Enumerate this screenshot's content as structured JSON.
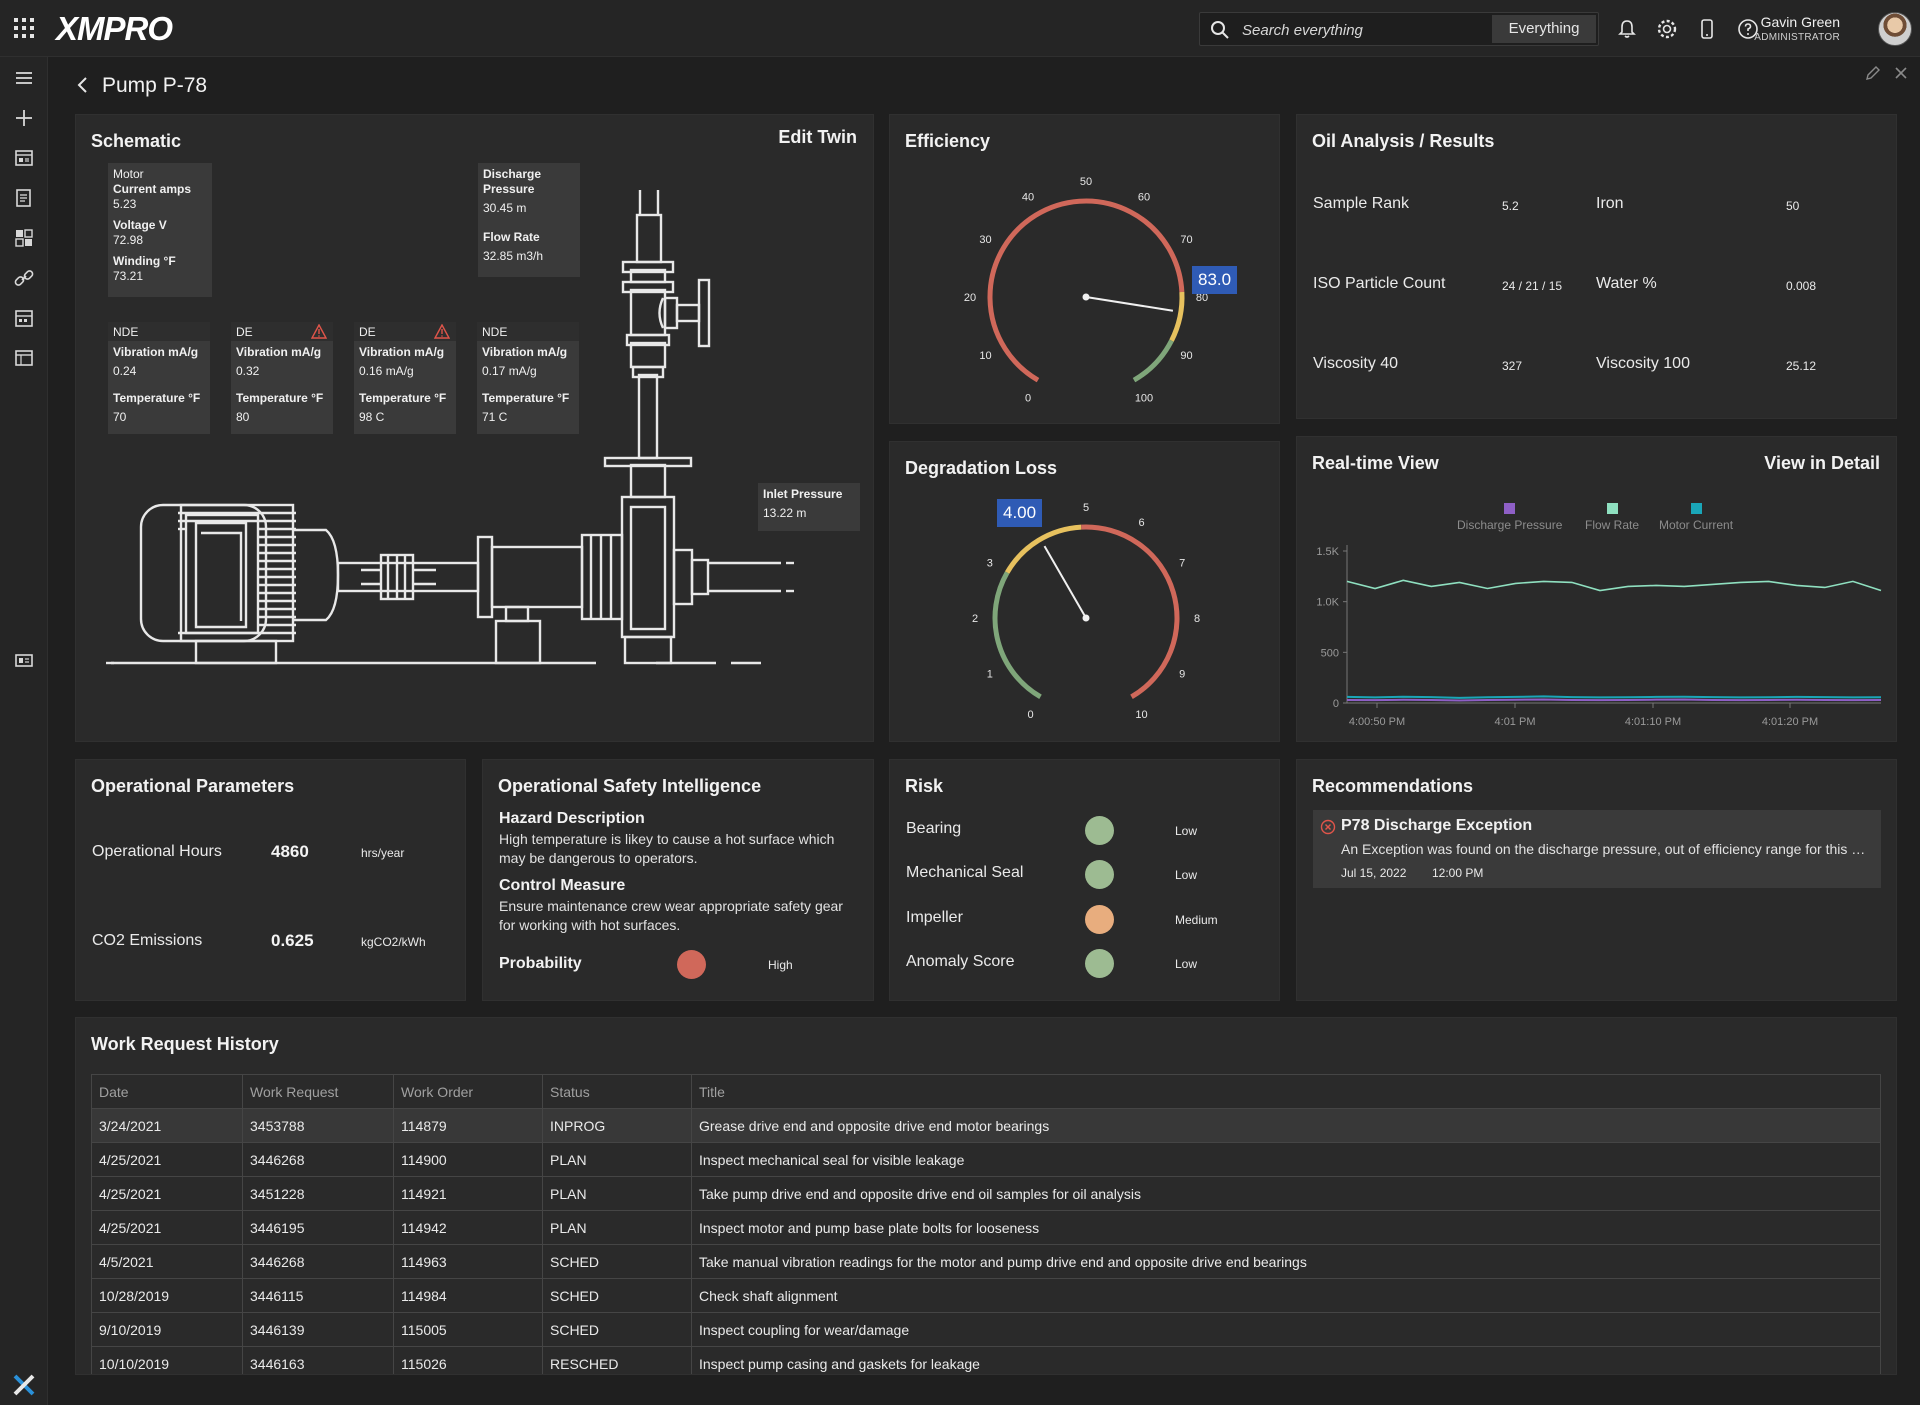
{
  "app": {
    "logo": "XMPRO"
  },
  "search": {
    "placeholder": "Search everything",
    "scope": "Everything"
  },
  "user": {
    "name": "Gavin Green",
    "role": "ADMINISTRATOR"
  },
  "page": {
    "title": "Pump P-78"
  },
  "schematic": {
    "title": "Schematic",
    "action": "Edit Twin",
    "motor": {
      "header": "Motor",
      "current_label": "Current amps",
      "current_value": "5.23",
      "voltage_label": "Voltage V",
      "voltage_value": "72.98",
      "winding_label": "Winding °F",
      "winding_value": "73.21"
    },
    "discharge": {
      "pressure_label": "Discharge Pressure",
      "pressure_value": "30.45 m",
      "flow_label": "Flow Rate",
      "flow_value": "32.85 m3/h"
    },
    "inlet": {
      "label": "Inlet Pressure",
      "value": "13.22 m"
    },
    "sensors": [
      {
        "header": "NDE",
        "vib_label": "Vibration mA/g",
        "vib_value": "0.24",
        "temp_label": "Temperature °F",
        "temp_value": "70",
        "warning": false
      },
      {
        "header": "DE",
        "vib_label": "Vibration mA/g",
        "vib_value": "0.32",
        "temp_label": "Temperature °F",
        "temp_value": "80",
        "warning": true
      },
      {
        "header": "DE",
        "vib_label": "Vibration mA/g",
        "vib_value": "0.16 mA/g",
        "temp_label": "Temperature °F",
        "temp_value": "98 C",
        "warning": true
      },
      {
        "header": "NDE",
        "vib_label": "Vibration mA/g",
        "vib_value": "0.17 mA/g",
        "temp_label": "Temperature °F",
        "temp_value": "71 C",
        "warning": false
      }
    ]
  },
  "efficiency": {
    "title": "Efficiency",
    "value": "83.0",
    "value_num": 83.0,
    "min": 0,
    "max": 100,
    "ticks": [
      "0",
      "10",
      "20",
      "30",
      "40",
      "50",
      "60",
      "70",
      "80",
      "90",
      "100"
    ]
  },
  "degradation": {
    "title": "Degradation Loss",
    "value": "4.00",
    "value_num": 4.0,
    "min": 0,
    "max": 10,
    "ticks": [
      "0",
      "1",
      "2",
      "3",
      "4",
      "5",
      "6",
      "7",
      "8",
      "9",
      "10"
    ]
  },
  "oil": {
    "title": "Oil Analysis / Results",
    "rows": [
      {
        "l1": "Sample Rank",
        "v1": "5.2",
        "l2": "Iron",
        "v2": "50"
      },
      {
        "l1": "ISO Particle Count",
        "v1": "24 / 21 / 15",
        "l2": "Water %",
        "v2": "0.008"
      },
      {
        "l1": "Viscosity 40",
        "v1": "327",
        "l2": "Viscosity 100",
        "v2": "25.12"
      }
    ]
  },
  "realtime": {
    "title": "Real-time View",
    "action": "View in Detail",
    "chart_data": {
      "type": "line",
      "x": [
        "4:00:50 PM",
        "4:01 PM",
        "4:01:10 PM",
        "4:01:20 PM"
      ],
      "yticks": [
        "0",
        "500",
        "1.0K",
        "1.5K"
      ],
      "ylim": [
        0,
        1500
      ],
      "legend_position": "top",
      "series": [
        {
          "name": "Discharge Pressure",
          "color": "#8e5fc6",
          "values": [
            30,
            28,
            32,
            30,
            25,
            30,
            32,
            35,
            30,
            28,
            30,
            33,
            35,
            30,
            28,
            30,
            32,
            30,
            28,
            30
          ]
        },
        {
          "name": "Flow Rate",
          "color": "#8fe0c0",
          "values": [
            1200,
            1130,
            1210,
            1150,
            1190,
            1130,
            1180,
            1200,
            1190,
            1110,
            1150,
            1160,
            1150,
            1170,
            1190,
            1200,
            1160,
            1140,
            1200,
            1110
          ]
        },
        {
          "name": "Motor Current",
          "color": "#1aa6b8",
          "values": [
            60,
            55,
            62,
            58,
            50,
            57,
            60,
            65,
            58,
            55,
            57,
            60,
            62,
            58,
            55,
            57,
            60,
            58,
            55,
            57
          ]
        }
      ]
    }
  },
  "opparams": {
    "title": "Operational Parameters",
    "rows": [
      {
        "label": "Operational Hours",
        "value": "4860",
        "unit": "hrs/year"
      },
      {
        "label": "CO2 Emissions",
        "value": "0.625",
        "unit": "kgCO2/kWh"
      }
    ]
  },
  "safety": {
    "title": "Operational Safety Intelligence",
    "hazard_title": "Hazard Description",
    "hazard_text": "High temperature is likey to cause a hot surface which may be dangerous to operators.",
    "control_title": "Control Measure",
    "control_text": "Ensure maintenance crew wear appropriate safety gear for working with hot surfaces.",
    "prob_label": "Probability",
    "prob_level": "High",
    "prob_color": "#d0685a"
  },
  "risk": {
    "title": "Risk",
    "items": [
      {
        "label": "Bearing",
        "level": "Low",
        "color": "#9dbb92"
      },
      {
        "label": "Mechanical Seal",
        "level": "Low",
        "color": "#9dbb92"
      },
      {
        "label": "Impeller",
        "level": "Medium",
        "color": "#e8ad7e"
      },
      {
        "label": "Anomaly Score",
        "level": "Low",
        "color": "#9dbb92"
      }
    ]
  },
  "recommendations": {
    "title": "Recommendations",
    "items": [
      {
        "title": "P78 Discharge Exception",
        "text": "An Exception was found on the discharge pressure, out of efficiency range for this pump",
        "date": "Jul 15, 2022",
        "time": "12:00 PM"
      }
    ]
  },
  "workrequests": {
    "title": "Work Request History",
    "columns": [
      "Date",
      "Work Request",
      "Work Order",
      "Status",
      "Title"
    ],
    "rows": [
      [
        "3/24/2021",
        "3453788",
        "114879",
        "INPROG",
        "Grease drive end and opposite drive end motor bearings"
      ],
      [
        "4/25/2021",
        "3446268",
        "114900",
        "PLAN",
        "Inspect mechanical seal for visible leakage"
      ],
      [
        "4/25/2021",
        "3451228",
        "114921",
        "PLAN",
        "Take pump drive end and opposite drive end oil samples for oil analysis"
      ],
      [
        "4/25/2021",
        "3446195",
        "114942",
        "PLAN",
        "Inspect motor and pump base plate bolts for looseness"
      ],
      [
        "4/5/2021",
        "3446268",
        "114963",
        "SCHED",
        "Take manual vibration readings for the motor and pump drive end and opposite drive end bearings"
      ],
      [
        "10/28/2019",
        "3446115",
        "114984",
        "SCHED",
        "Check shaft alignment"
      ],
      [
        "9/10/2019",
        "3446139",
        "115005",
        "SCHED",
        "Inspect coupling for wear/damage"
      ],
      [
        "10/10/2019",
        "3446163",
        "115026",
        "RESCHED",
        "Inspect pump casing and gaskets for leakage"
      ]
    ]
  }
}
